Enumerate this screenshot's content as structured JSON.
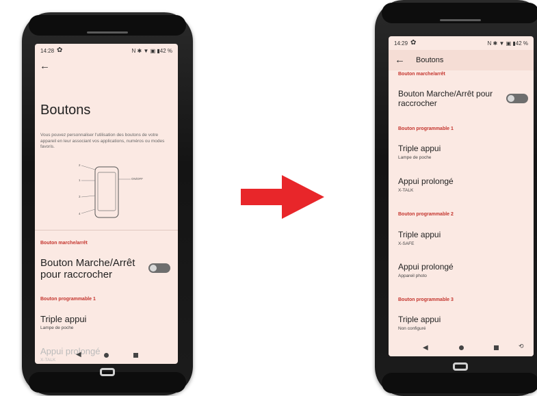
{
  "left_screen": {
    "status": {
      "time": "14:28",
      "right": "N ✱ ▼ ▣ ▮42 %"
    },
    "page_title": "Boutons",
    "description": "Vous pouvez personnaliser l'utilisation des boutons de votre appareil en leur associant vos applications, numéros ou modes favoris.",
    "diagram_labels": [
      "2",
      "1",
      "ON/OFF",
      "3",
      "4"
    ],
    "section_power": "Bouton marche/arrêt",
    "power_item": "Bouton Marche/Arrêt pour raccrocher",
    "section_prog1": "Bouton programmable 1",
    "triple_title": "Triple appui",
    "triple_sub": "Lampe de poche",
    "long_title": "Appui prolongé",
    "long_sub": "X-TALK"
  },
  "right_screen": {
    "status": {
      "time": "14:29",
      "right": "N ✱ ▼ ▣ ▮42 %"
    },
    "app_bar_title": "Boutons",
    "section_power": "Bouton marche/arrêt",
    "power_item": "Bouton Marche/Arrêt pour raccrocher",
    "sections": [
      {
        "header": "Bouton programmable 1",
        "items": [
          {
            "title": "Triple appui",
            "sub": "Lampe de poche"
          },
          {
            "title": "Appui prolongé",
            "sub": "X-TALK"
          }
        ]
      },
      {
        "header": "Bouton programmable 2",
        "items": [
          {
            "title": "Triple appui",
            "sub": "X-SAFE"
          },
          {
            "title": "Appui prolongé",
            "sub": "Appareil photo"
          }
        ]
      },
      {
        "header": "Bouton programmable 3",
        "items": [
          {
            "title": "Triple appui",
            "sub": "Non configuré"
          }
        ]
      }
    ]
  },
  "colors": {
    "accent": "#c4342d",
    "screen_bg": "#fbe9e3",
    "arrow": "#e8262a"
  },
  "icons": [
    "gear-icon",
    "back-arrow-icon",
    "toggle-switch",
    "nav-back-icon",
    "nav-home-icon",
    "nav-recents-icon",
    "rotate-icon",
    "arrow-right-icon",
    "brand-logo-icon"
  ]
}
